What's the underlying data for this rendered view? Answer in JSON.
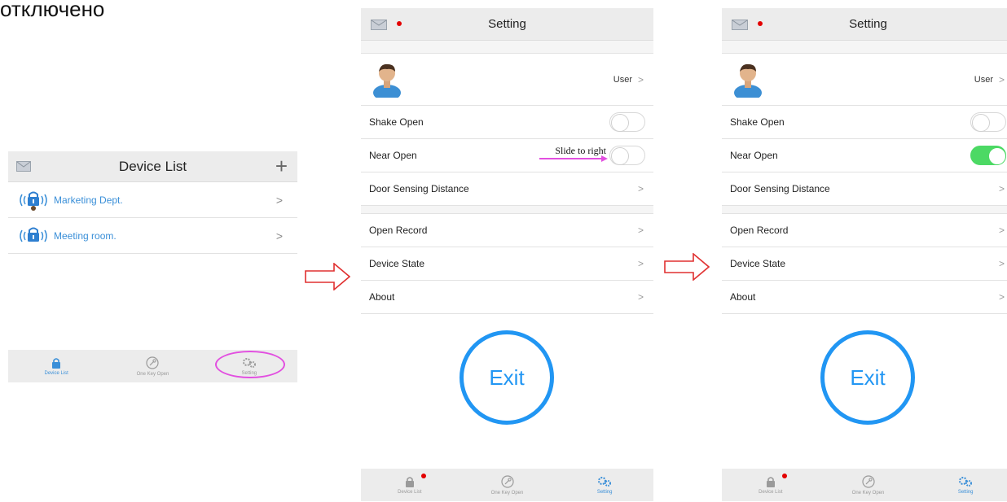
{
  "heading": "отключено",
  "device_list_screen": {
    "title": "Device List",
    "add_label": "+",
    "devices": [
      {
        "name": "Marketing Dept.",
        "chevron": ">"
      },
      {
        "name": "Meeting room.",
        "chevron": ">"
      }
    ],
    "tabs": [
      {
        "label": "Device List",
        "icon": "lock-icon"
      },
      {
        "label": "One Key Open",
        "icon": "key-icon"
      },
      {
        "label": "Setting",
        "icon": "gear-icon"
      }
    ]
  },
  "setting_screen_1": {
    "title": "Setting",
    "user_label": "User",
    "rows_group1": [
      {
        "label": "Shake Open",
        "type": "toggle",
        "on": false
      },
      {
        "label": "Near Open",
        "type": "toggle",
        "on": false
      },
      {
        "label": "Door Sensing Distance",
        "type": "chevron"
      }
    ],
    "slide_hint": "Slide to right",
    "rows_group2": [
      {
        "label": "Open Record"
      },
      {
        "label": "Device State"
      },
      {
        "label": "About"
      }
    ],
    "exit_label": "Exit",
    "tabs": [
      {
        "label": "Device List"
      },
      {
        "label": "One Key Open"
      },
      {
        "label": "Setting"
      }
    ]
  },
  "setting_screen_2": {
    "title": "Setting",
    "user_label": "User",
    "rows_group1": [
      {
        "label": "Shake Open",
        "type": "toggle",
        "on": false
      },
      {
        "label": "Near Open",
        "type": "toggle",
        "on": true
      },
      {
        "label": "Door Sensing Distance",
        "type": "chevron"
      }
    ],
    "rows_group2": [
      {
        "label": "Open Record"
      },
      {
        "label": "Device State"
      },
      {
        "label": "About"
      }
    ],
    "exit_label": "Exit",
    "tabs": [
      {
        "label": "Device List"
      },
      {
        "label": "One Key Open"
      },
      {
        "label": "Setting"
      }
    ]
  },
  "colors": {
    "accent_blue": "#2196f3",
    "link_blue": "#3a8fd8",
    "toggle_on": "#4cd964",
    "notify_red": "#e30000",
    "annotation_magenta": "#e24fe0",
    "arrow_red": "#e03030"
  }
}
